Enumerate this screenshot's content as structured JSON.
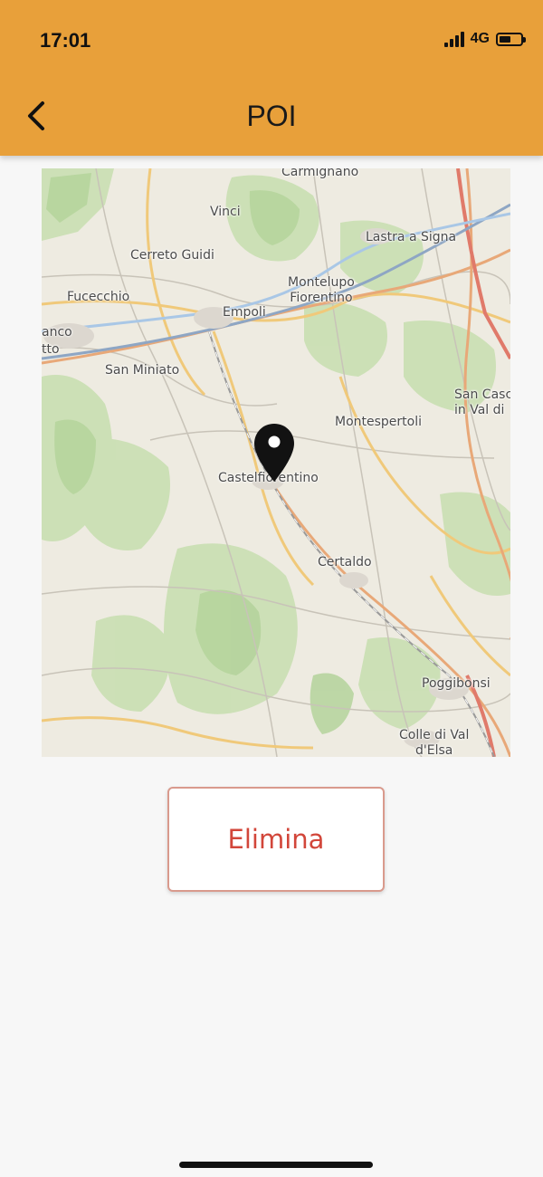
{
  "status_bar": {
    "time": "17:01",
    "network": "4G",
    "battery_level": 0.55
  },
  "header": {
    "title": "POI",
    "background_color": "#e8a03a",
    "back_icon": "chevron-left-icon"
  },
  "map": {
    "pin_icon": "map-pin-icon",
    "place_labels": [
      {
        "key": "carmignano",
        "text": "Carmignano"
      },
      {
        "key": "vinci",
        "text": "Vinci"
      },
      {
        "key": "lastra-a-signa",
        "text": "Lastra a Signa"
      },
      {
        "key": "cerreto-guidi",
        "text": "Cerreto Guidi"
      },
      {
        "key": "montelupo-fiorentino",
        "text": "Montelupo\nFiorentino"
      },
      {
        "key": "fucecchio",
        "text": "Fucecchio"
      },
      {
        "key": "empoli",
        "text": "Empoli"
      },
      {
        "key": "anco",
        "text": "anco"
      },
      {
        "key": "tto",
        "text": "tto"
      },
      {
        "key": "san-miniato",
        "text": "San Miniato"
      },
      {
        "key": "san-casciano",
        "text": "San Casc\nin Val di"
      },
      {
        "key": "montespertoli",
        "text": "Montespertoli"
      },
      {
        "key": "castelfiorentino",
        "text": "Castelfiorentino"
      },
      {
        "key": "certaldo",
        "text": "Certaldo"
      },
      {
        "key": "poggibonsi",
        "text": "Poggibonsi"
      },
      {
        "key": "colle-di-val-d-elsa",
        "text": "Colle di Val\nd'Elsa"
      }
    ]
  },
  "actions": {
    "delete_label": "Elimina",
    "delete_color": "#d2463a"
  }
}
